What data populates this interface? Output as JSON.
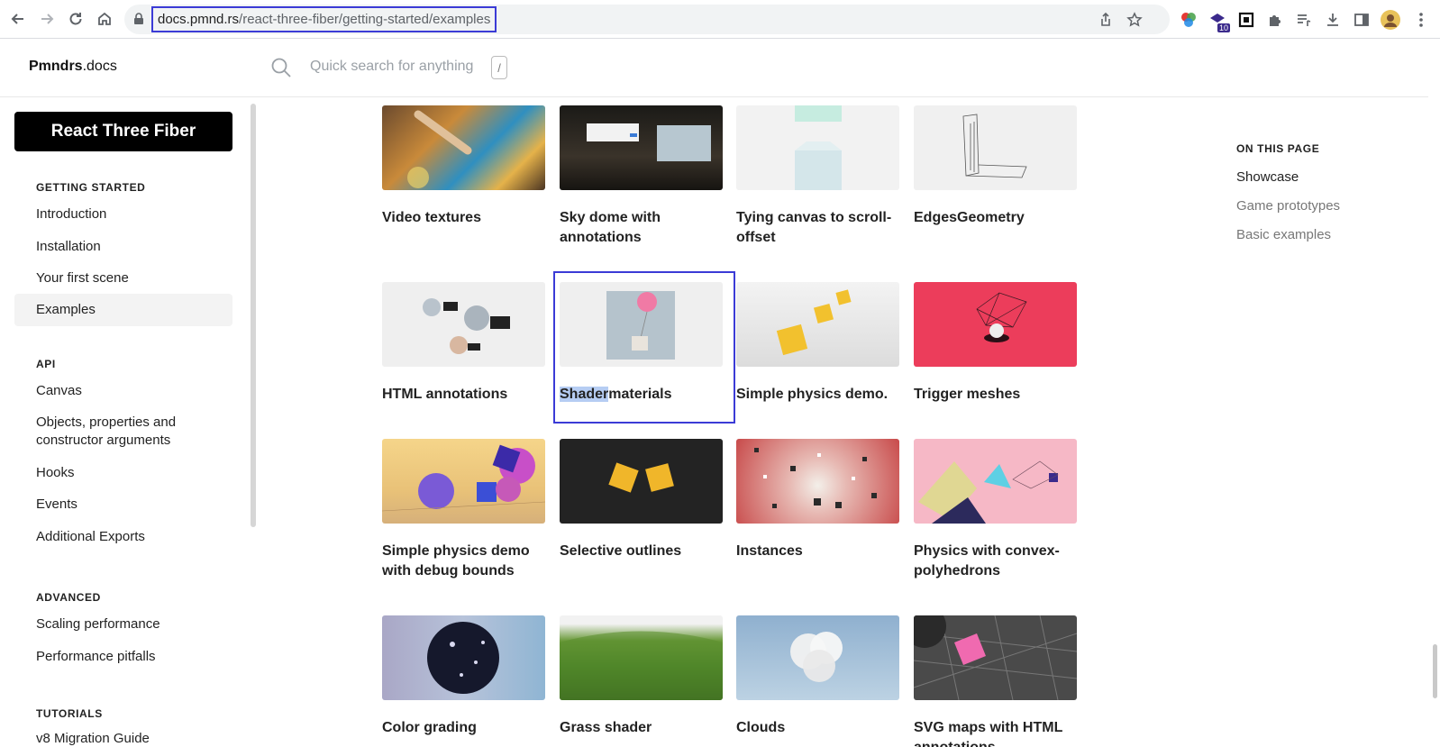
{
  "browser": {
    "url_host": "docs.pmnd.rs",
    "url_path": "/react-three-fiber/getting-started/examples",
    "extension_badge": "10"
  },
  "header": {
    "brand_bold": "Pmndrs",
    "brand_rest": ".docs",
    "search_placeholder": "Quick search for anything",
    "search_shortcut": "/"
  },
  "sidebar": {
    "product_button": "React Three Fiber",
    "sections": [
      {
        "title": "GETTING STARTED",
        "items": [
          "Introduction",
          "Installation",
          "Your first scene",
          "Examples"
        ]
      },
      {
        "title": "API",
        "items": [
          "Canvas",
          "Objects, properties and constructor arguments",
          "Hooks",
          "Events",
          "Additional Exports"
        ]
      },
      {
        "title": "ADVANCED",
        "items": [
          "Scaling performance",
          "Performance pitfalls"
        ]
      },
      {
        "title": "TUTORIALS",
        "items": [
          "v8 Migration Guide"
        ]
      }
    ],
    "active_item": "Examples"
  },
  "examples": [
    {
      "title": "Video textures"
    },
    {
      "title": "Sky dome with annotations"
    },
    {
      "title": "Tying canvas to scroll-offset"
    },
    {
      "title": "EdgesGeometry"
    },
    {
      "title": "HTML annotations"
    },
    {
      "title_selected": "Shader",
      "title_rest": "materials"
    },
    {
      "title": "Simple physics demo."
    },
    {
      "title": "Trigger meshes"
    },
    {
      "title": "Simple physics demo with debug bounds"
    },
    {
      "title": "Selective outlines"
    },
    {
      "title": "Instances"
    },
    {
      "title": "Physics with convex-polyhedrons"
    },
    {
      "title": "Color grading"
    },
    {
      "title": "Grass shader"
    },
    {
      "title": "Clouds"
    },
    {
      "title": "SVG maps with HTML annotations"
    }
  ],
  "toc": {
    "title": "ON THIS PAGE",
    "items": [
      "Showcase",
      "Game prototypes",
      "Basic examples"
    ],
    "active": "Showcase"
  }
}
